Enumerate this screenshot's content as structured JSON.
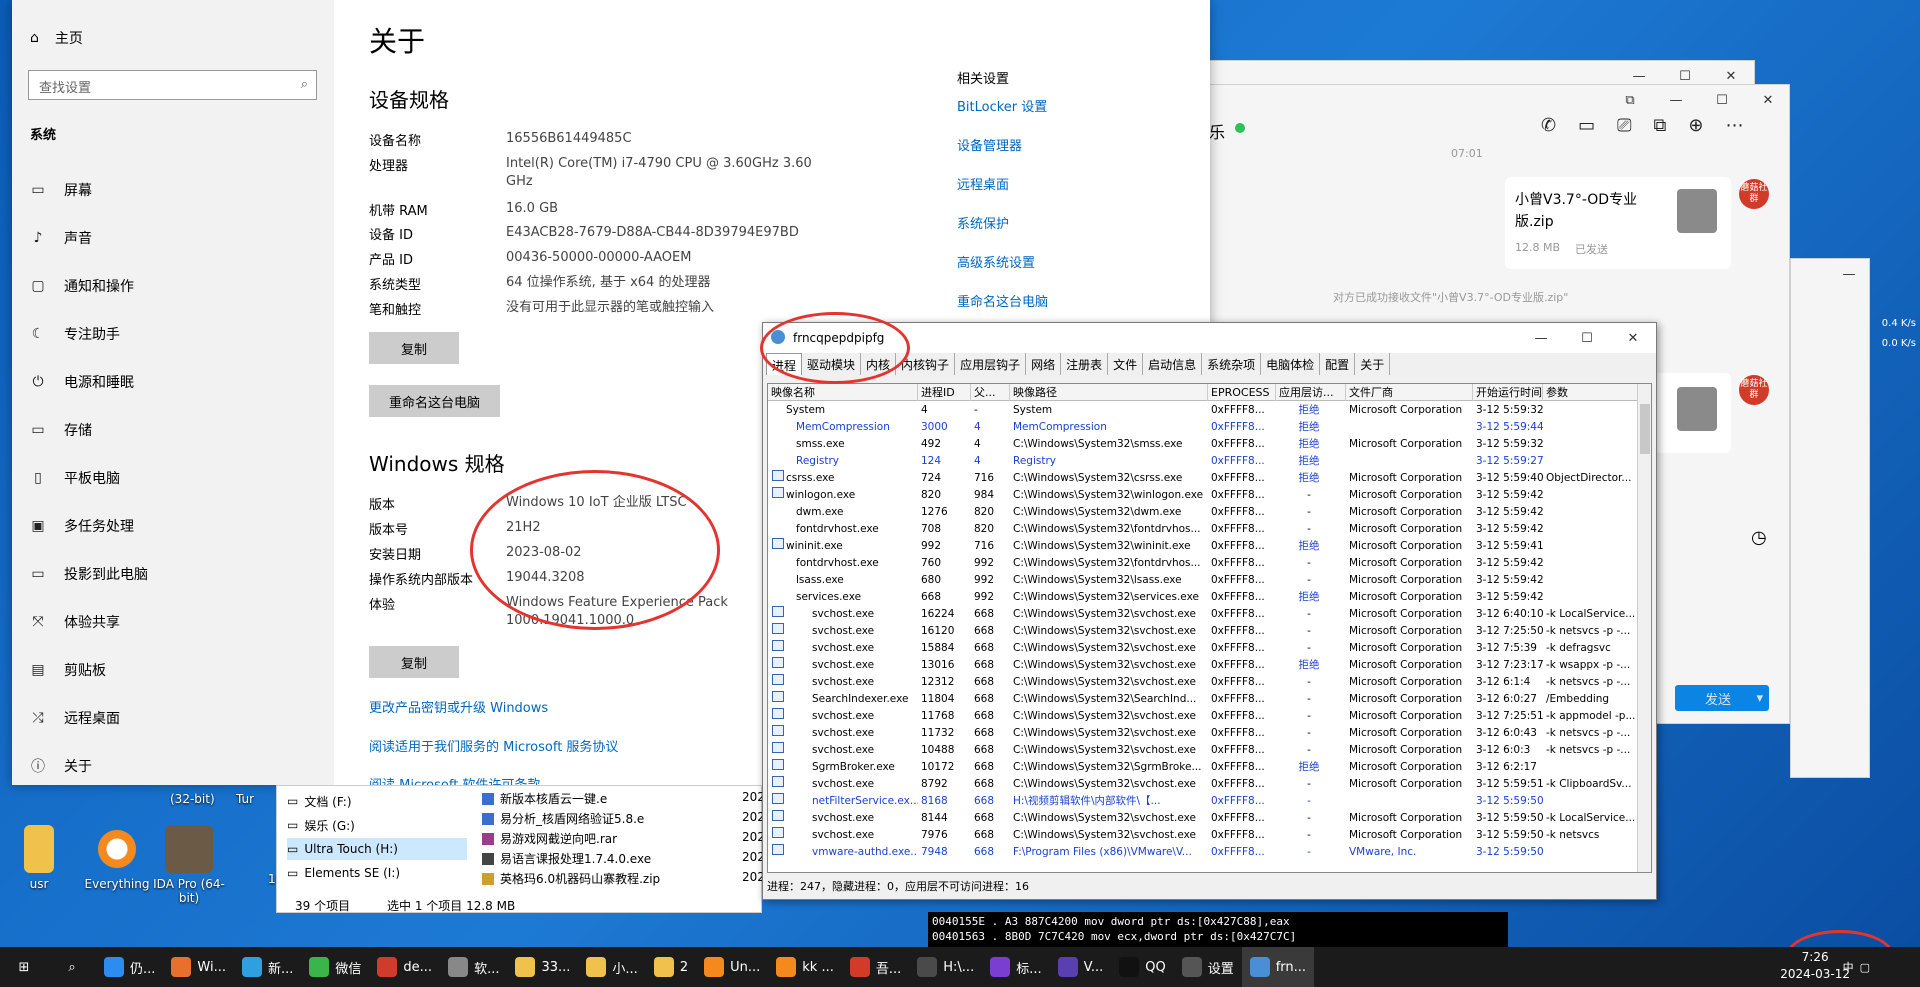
{
  "settings": {
    "home": "主页",
    "search_placeholder": "查找设置",
    "category": "系统",
    "nav": [
      "屏幕",
      "声音",
      "通知和操作",
      "专注助手",
      "电源和睡眠",
      "存储",
      "平板电脑",
      "多任务处理",
      "投影到此电脑",
      "体验共享",
      "剪贴板",
      "远程桌面",
      "关于"
    ],
    "nav_icons": [
      "monitor-icon",
      "speaker-icon",
      "notification-icon",
      "moon-icon",
      "power-icon",
      "storage-icon",
      "tablet-icon",
      "multitask-icon",
      "project-icon",
      "share-icon",
      "clipboard-icon",
      "remote-icon",
      "info-icon"
    ],
    "title": "关于",
    "device_spec_title": "设备规格",
    "device_specs": [
      {
        "k": "设备名称",
        "v": "16556B61449485C"
      },
      {
        "k": "处理器",
        "v": "Intel(R) Core(TM) i7-4790 CPU @ 3.60GHz   3.60 GHz"
      },
      {
        "k": "机带 RAM",
        "v": "16.0 GB"
      },
      {
        "k": "设备 ID",
        "v": "E43ACB28-7679-D88A-CB44-8D39794E97BD"
      },
      {
        "k": "产品 ID",
        "v": "00436-50000-00000-AAOEM"
      },
      {
        "k": "系统类型",
        "v": "64 位操作系统, 基于 x64 的处理器"
      },
      {
        "k": "笔和触控",
        "v": "没有可用于此显示器的笔或触控输入"
      }
    ],
    "copy_label": "复制",
    "rename_label": "重命名这台电脑",
    "win_spec_title": "Windows 规格",
    "win_specs": [
      {
        "k": "版本",
        "v": "Windows 10 IoT 企业版 LTSC"
      },
      {
        "k": "版本号",
        "v": "21H2"
      },
      {
        "k": "安装日期",
        "v": "2023-08-02"
      },
      {
        "k": "操作系统内部版本",
        "v": "19044.3208"
      },
      {
        "k": "体验",
        "v": "Windows Feature Experience Pack 1000.19041.1000.0"
      }
    ],
    "copy2_label": "复制",
    "link1": "更改产品密钥或升级 Windows",
    "link2": "阅读适用于我们服务的 Microsoft 服务协议",
    "link3": "阅读 Microsoft 软件许可条款",
    "related_title": "相关设置",
    "related": [
      "BitLocker 设置",
      "设备管理器",
      "远程桌面",
      "系统保护",
      "高级系统设置",
      "重命名这台电脑"
    ]
  },
  "chat": {
    "name_fragment": "乐",
    "time": "07:01",
    "file1": {
      "name": "小曾V3.7°-OD专业版.zip",
      "size": "12.8 MB",
      "status": "已发送"
    },
    "notice": "对方已成功接收文件\"小曾V3.7°-OD专业版.zip\"",
    "badge_text": "蘑菇社群",
    "num4": "4",
    "send_label": "发送"
  },
  "ptool": {
    "title": "frncqpepdpipfg",
    "tabs": [
      "进程",
      "驱动模块",
      "内核",
      "内核钩子",
      "应用层钩子",
      "网络",
      "注册表",
      "文件",
      "启动信息",
      "系统杂项",
      "电脑体检",
      "配置",
      "关于"
    ],
    "columns": [
      "映像名称",
      "进程ID",
      "父...",
      "映像路径",
      "EPROCESS",
      "应用层访...",
      "文件厂商",
      "开始运行时间",
      "参数"
    ],
    "rows": [
      {
        "n": "System",
        "pid": "4",
        "ppid": "-",
        "path": "System",
        "ep": "0xFFFF8...",
        "acc": "拒绝",
        "vendor": "Microsoft Corporation",
        "time": "3-12 5:59:32",
        "arg": "",
        "blue": false,
        "ind": 1
      },
      {
        "n": "MemCompression",
        "pid": "3000",
        "ppid": "4",
        "path": "MemCompression",
        "ep": "0xFFFF8...",
        "acc": "拒绝",
        "vendor": "",
        "time": "3-12 5:59:44",
        "arg": "",
        "blue": true,
        "ind": 2
      },
      {
        "n": "smss.exe",
        "pid": "492",
        "ppid": "4",
        "path": "C:\\Windows\\System32\\smss.exe",
        "ep": "0xFFFF8...",
        "acc": "拒绝",
        "vendor": "Microsoft Corporation",
        "time": "3-12 5:59:32",
        "arg": "",
        "blue": false,
        "ind": 2
      },
      {
        "n": "Registry",
        "pid": "124",
        "ppid": "4",
        "path": "Registry",
        "ep": "0xFFFF8...",
        "acc": "拒绝",
        "vendor": "",
        "time": "3-12 5:59:27",
        "arg": "",
        "blue": true,
        "ind": 2
      },
      {
        "n": "csrss.exe",
        "pid": "724",
        "ppid": "716",
        "path": "C:\\Windows\\System32\\csrss.exe",
        "ep": "0xFFFF8...",
        "acc": "拒绝",
        "vendor": "Microsoft Corporation",
        "time": "3-12 5:59:40",
        "arg": "ObjectDirector...",
        "blue": false,
        "ind": 0
      },
      {
        "n": "winlogon.exe",
        "pid": "820",
        "ppid": "984",
        "path": "C:\\Windows\\System32\\winlogon.exe",
        "ep": "0xFFFF8...",
        "acc": "-",
        "vendor": "Microsoft Corporation",
        "time": "3-12 5:59:42",
        "arg": "",
        "blue": false,
        "ind": 0
      },
      {
        "n": "dwm.exe",
        "pid": "1276",
        "ppid": "820",
        "path": "C:\\Windows\\System32\\dwm.exe",
        "ep": "0xFFFF8...",
        "acc": "-",
        "vendor": "Microsoft Corporation",
        "time": "3-12 5:59:42",
        "arg": "",
        "blue": false,
        "ind": 2
      },
      {
        "n": "fontdrvhost.exe",
        "pid": "708",
        "ppid": "820",
        "path": "C:\\Windows\\System32\\fontdrvhos...",
        "ep": "0xFFFF8...",
        "acc": "-",
        "vendor": "Microsoft Corporation",
        "time": "3-12 5:59:42",
        "arg": "",
        "blue": false,
        "ind": 2
      },
      {
        "n": "wininit.exe",
        "pid": "992",
        "ppid": "716",
        "path": "C:\\Windows\\System32\\wininit.exe",
        "ep": "0xFFFF8...",
        "acc": "拒绝",
        "vendor": "Microsoft Corporation",
        "time": "3-12 5:59:41",
        "arg": "",
        "blue": false,
        "ind": 0
      },
      {
        "n": "fontdrvhost.exe",
        "pid": "760",
        "ppid": "992",
        "path": "C:\\Windows\\System32\\fontdrvhos...",
        "ep": "0xFFFF8...",
        "acc": "-",
        "vendor": "Microsoft Corporation",
        "time": "3-12 5:59:42",
        "arg": "",
        "blue": false,
        "ind": 2
      },
      {
        "n": "lsass.exe",
        "pid": "680",
        "ppid": "992",
        "path": "C:\\Windows\\System32\\lsass.exe",
        "ep": "0xFFFF8...",
        "acc": "-",
        "vendor": "Microsoft Corporation",
        "time": "3-12 5:59:42",
        "arg": "",
        "blue": false,
        "ind": 2
      },
      {
        "n": "services.exe",
        "pid": "668",
        "ppid": "992",
        "path": "C:\\Windows\\System32\\services.exe",
        "ep": "0xFFFF8...",
        "acc": "拒绝",
        "vendor": "Microsoft Corporation",
        "time": "3-12 5:59:42",
        "arg": "",
        "blue": false,
        "ind": 2
      },
      {
        "n": "svchost.exe",
        "pid": "16224",
        "ppid": "668",
        "path": "C:\\Windows\\System32\\svchost.exe",
        "ep": "0xFFFF8...",
        "acc": "-",
        "vendor": "Microsoft Corporation",
        "time": "3-12 6:40:10",
        "arg": "-k LocalService...",
        "blue": false,
        "ind": 3
      },
      {
        "n": "svchost.exe",
        "pid": "16120",
        "ppid": "668",
        "path": "C:\\Windows\\System32\\svchost.exe",
        "ep": "0xFFFF8...",
        "acc": "-",
        "vendor": "Microsoft Corporation",
        "time": "3-12 7:25:50",
        "arg": "-k netsvcs -p -...",
        "blue": false,
        "ind": 3
      },
      {
        "n": "svchost.exe",
        "pid": "15884",
        "ppid": "668",
        "path": "C:\\Windows\\System32\\svchost.exe",
        "ep": "0xFFFF8...",
        "acc": "-",
        "vendor": "Microsoft Corporation",
        "time": "3-12 7:5:39",
        "arg": "-k defragsvc",
        "blue": false,
        "ind": 3
      },
      {
        "n": "svchost.exe",
        "pid": "13016",
        "ppid": "668",
        "path": "C:\\Windows\\System32\\svchost.exe",
        "ep": "0xFFFF8...",
        "acc": "拒绝",
        "vendor": "Microsoft Corporation",
        "time": "3-12 7:23:17",
        "arg": "-k wsappx -p -...",
        "blue": false,
        "ind": 3
      },
      {
        "n": "svchost.exe",
        "pid": "12312",
        "ppid": "668",
        "path": "C:\\Windows\\System32\\svchost.exe",
        "ep": "0xFFFF8...",
        "acc": "-",
        "vendor": "Microsoft Corporation",
        "time": "3-12 6:1:4",
        "arg": "-k netsvcs -p -...",
        "blue": false,
        "ind": 3
      },
      {
        "n": "SearchIndexer.exe",
        "pid": "11804",
        "ppid": "668",
        "path": "C:\\Windows\\System32\\SearchInd...",
        "ep": "0xFFFF8...",
        "acc": "-",
        "vendor": "Microsoft Corporation",
        "time": "3-12 6:0:27",
        "arg": "/Embedding",
        "blue": false,
        "ind": 3
      },
      {
        "n": "svchost.exe",
        "pid": "11768",
        "ppid": "668",
        "path": "C:\\Windows\\System32\\svchost.exe",
        "ep": "0xFFFF8...",
        "acc": "-",
        "vendor": "Microsoft Corporation",
        "time": "3-12 7:25:51",
        "arg": "-k appmodel -p...",
        "blue": false,
        "ind": 3
      },
      {
        "n": "svchost.exe",
        "pid": "11732",
        "ppid": "668",
        "path": "C:\\Windows\\System32\\svchost.exe",
        "ep": "0xFFFF8...",
        "acc": "-",
        "vendor": "Microsoft Corporation",
        "time": "3-12 6:0:43",
        "arg": "-k netsvcs -p -...",
        "blue": false,
        "ind": 3
      },
      {
        "n": "svchost.exe",
        "pid": "10488",
        "ppid": "668",
        "path": "C:\\Windows\\System32\\svchost.exe",
        "ep": "0xFFFF8...",
        "acc": "-",
        "vendor": "Microsoft Corporation",
        "time": "3-12 6:0:3",
        "arg": "-k netsvcs -p -...",
        "blue": false,
        "ind": 3
      },
      {
        "n": "SgrmBroker.exe",
        "pid": "10172",
        "ppid": "668",
        "path": "C:\\Windows\\System32\\SgrmBroke...",
        "ep": "0xFFFF8...",
        "acc": "拒绝",
        "vendor": "Microsoft Corporation",
        "time": "3-12 6:2:17",
        "arg": "",
        "blue": false,
        "ind": 3
      },
      {
        "n": "svchost.exe",
        "pid": "8792",
        "ppid": "668",
        "path": "C:\\Windows\\System32\\svchost.exe",
        "ep": "0xFFFF8...",
        "acc": "-",
        "vendor": "Microsoft Corporation",
        "time": "3-12 5:59:51",
        "arg": "-k ClipboardSv...",
        "blue": false,
        "ind": 3
      },
      {
        "n": "netFilterService.ex...",
        "pid": "8168",
        "ppid": "668",
        "path": "H:\\视频剪辑软件\\内部软件\\【...",
        "ep": "0xFFFF8...",
        "acc": "-",
        "vendor": "",
        "time": "3-12 5:59:50",
        "arg": "",
        "blue": true,
        "ind": 3
      },
      {
        "n": "svchost.exe",
        "pid": "8144",
        "ppid": "668",
        "path": "C:\\Windows\\System32\\svchost.exe",
        "ep": "0xFFFF8...",
        "acc": "-",
        "vendor": "Microsoft Corporation",
        "time": "3-12 5:59:50",
        "arg": "-k LocalService...",
        "blue": false,
        "ind": 3
      },
      {
        "n": "svchost.exe",
        "pid": "7976",
        "ppid": "668",
        "path": "C:\\Windows\\System32\\svchost.exe",
        "ep": "0xFFFF8...",
        "acc": "-",
        "vendor": "Microsoft Corporation",
        "time": "3-12 5:59:50",
        "arg": "-k netsvcs",
        "blue": false,
        "ind": 3
      },
      {
        "n": "vmware-authd.exe...",
        "pid": "7948",
        "ppid": "668",
        "path": "F:\\Program Files (x86)\\VMware\\V...",
        "ep": "0xFFFF8...",
        "acc": "-",
        "vendor": "VMware, Inc.",
        "time": "3-12 5:59:50",
        "arg": "",
        "blue": true,
        "ind": 3
      }
    ],
    "status": "进程：247，隐藏进程：0，应用层不可访问进程：16"
  },
  "explorer": {
    "drives": [
      "文档 (F:)",
      "娱乐 (G:)",
      "Ultra Touch (H:)",
      "Elements SE (I:)"
    ],
    "files": [
      "新版本核盾云一键.e",
      "易分析_核盾网络验证5.8.e",
      "易游戏网截逆向吧.rar",
      "易语言课报处理1.7.4.0.exe",
      "英格玛6.0机器码山寨教程.zip"
    ],
    "year": "202",
    "items_count": "39 个项目",
    "selected": "选中 1 个项目  12.8 MB"
  },
  "debugger": {
    "line1": "0040155E  .  A3 887C4200  mov dword ptr ds:[0x427C88],eax",
    "line2": "00401563  .  8B0D 7C7C420  mov ecx,dword ptr ds:[0x427C7C]"
  },
  "desktop": {
    "icons": [
      "usr",
      "Everything",
      "IDA Pro (64-bit)"
    ],
    "small_text": [
      "(32-bit)",
      "Tur",
      "10",
      "Tc"
    ]
  },
  "taskbar": {
    "items": [
      "仍...",
      "Wi...",
      "新...",
      "微信",
      "de...",
      "软...",
      "33...",
      "小...",
      "2",
      "Un...",
      "kk ...",
      "吾...",
      "H:\\...",
      "标...",
      "V...",
      "QQ",
      "设置",
      "frn..."
    ],
    "clock_time": "7:26",
    "clock_date": "2024-03-12",
    "ime": "中",
    "net_up": "0.4 K/s",
    "net_down": "0.0 K/s"
  }
}
